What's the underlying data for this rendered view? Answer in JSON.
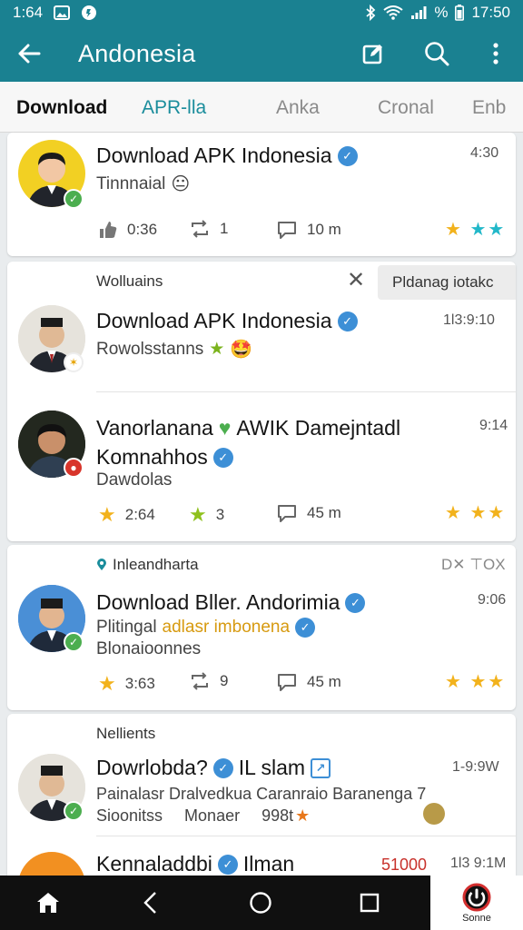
{
  "status_bar": {
    "time_left": "1:64",
    "time_right": "17:50",
    "battery_text": "%"
  },
  "app_bar": {
    "title": "Andonesia"
  },
  "tabs": [
    "Download",
    "APR-lla",
    "Anka",
    "Cronal",
    "Enb"
  ],
  "feed": {
    "item1": {
      "name": "Download APK Indonesia",
      "subtitle": "Tinnnaial",
      "time": "4:30",
      "stats": {
        "likes": "0:36",
        "reposts": "1",
        "comments": "10 m"
      }
    },
    "card2": {
      "header": "Wolluains",
      "chip": "Pldanag iotakc",
      "item1": {
        "name": "Download APK Indonesia",
        "subtitle": "Rowolsstanns",
        "time": "1l3:9:10"
      },
      "item2": {
        "name": "Vanorlanana",
        "name_suffix": "AWIK Damejntadl",
        "line2": "Komnahhos",
        "line3": "Dawdolas",
        "time": "9:14",
        "stats": {
          "stars": "2:64",
          "stars2": "3",
          "comments": "45 m"
        }
      }
    },
    "card3": {
      "header": "Inleandharta",
      "header_right": "D✕ ⊤OX",
      "item": {
        "name": "Download  Bller. Andorimia",
        "sub_plain": "Plitingal",
        "sub_highlight": "adlasr imbonena",
        "line3": "Blonaioonnes",
        "time": "9:06",
        "stats": {
          "stars": "3:63",
          "reposts": "9",
          "comments": "45 m"
        }
      }
    },
    "card4": {
      "header": "Nellients",
      "item1": {
        "name": "Dowrlobda?",
        "name_suffix": "IL slam",
        "time": "1-9:9W",
        "line2": "Painalasr Dralvedkua Caranraio Baranenga 7",
        "line3a": "Sioonitss",
        "line3b": "Monaer",
        "line3c": "998t"
      },
      "item2": {
        "name": "Kennaladdbi",
        "name_suffix": "Ilman",
        "badge": "51000",
        "time": "1l3 9:1M"
      }
    }
  },
  "nav_bar": {
    "right_label": "Sonne"
  },
  "colors": {
    "primary": "#1a8191",
    "accent": "#1a8d9c",
    "verified": "#3d8fd6",
    "star_gold": "#f2b21c",
    "star_teal": "#22b8c9"
  }
}
